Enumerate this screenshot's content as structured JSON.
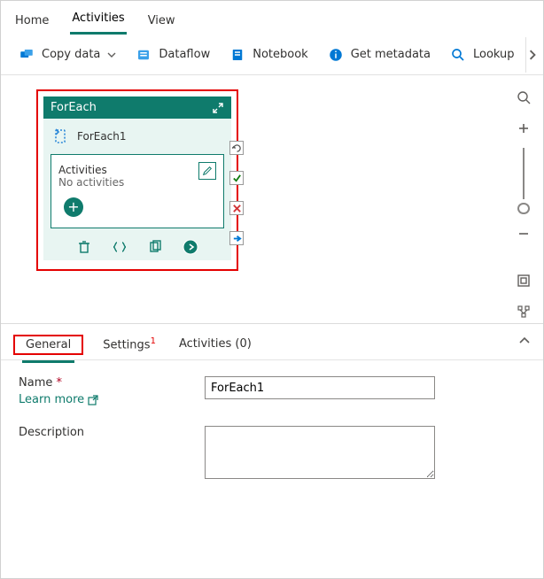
{
  "top_tabs": {
    "home": "Home",
    "activities": "Activities",
    "view": "View"
  },
  "toolbar": {
    "copy_data": "Copy data",
    "dataflow": "Dataflow",
    "notebook": "Notebook",
    "get_metadata": "Get metadata",
    "lookup": "Lookup"
  },
  "node": {
    "title": "ForEach",
    "instance_name": "ForEach1",
    "activities_label": "Activities",
    "no_activities": "No activities"
  },
  "props": {
    "tab_general": "General",
    "tab_settings": "Settings",
    "settings_badge": "1",
    "tab_activities": "Activities (0)",
    "name_label": "Name",
    "name_required": "*",
    "learn_more": "Learn more",
    "name_value": "ForEach1",
    "desc_label": "Description",
    "desc_value": ""
  }
}
